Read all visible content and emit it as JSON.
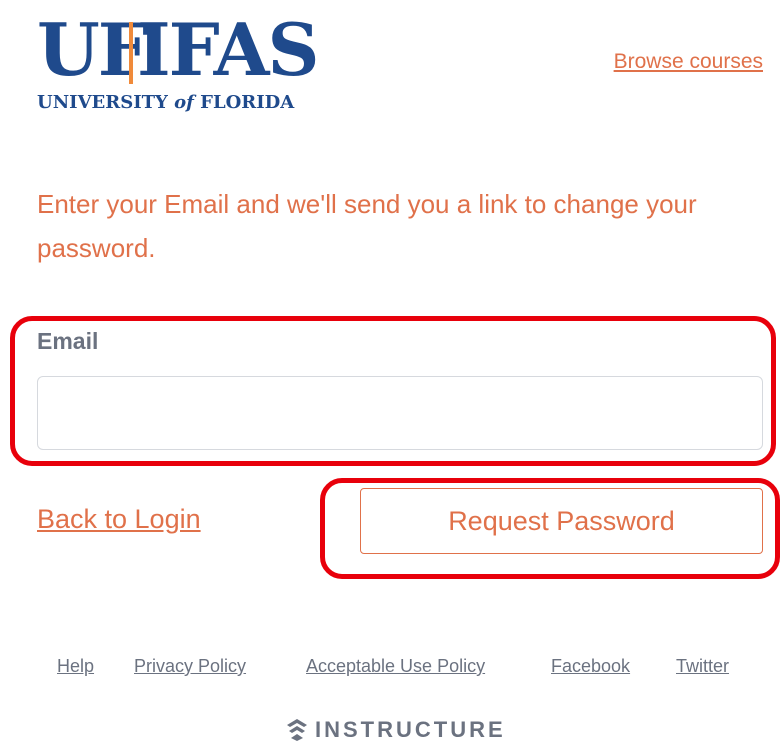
{
  "logo": {
    "left_text": "UF",
    "right_text": "IFAS",
    "sub_text_pre": "UNIVERSITY ",
    "sub_text_of": "of",
    "sub_text_post": " FLORIDA"
  },
  "header": {
    "browse_label": "Browse courses"
  },
  "form": {
    "instructions": "Enter your Email and we'll send you a link to change your password.",
    "email_label": "Email",
    "email_value": "",
    "email_placeholder": "",
    "back_label": "Back to Login",
    "submit_label": "Request Password"
  },
  "footer": {
    "links": [
      "Help",
      "Privacy Policy",
      "Acceptable Use Policy",
      "Facebook",
      "Twitter"
    ],
    "brand": "INSTRUCTURE"
  },
  "colors": {
    "accent": "#e0714a",
    "brand_blue": "#1f4a8c",
    "brand_orange": "#f08a3a",
    "highlight": "#e8000b",
    "muted": "#6b7280"
  }
}
